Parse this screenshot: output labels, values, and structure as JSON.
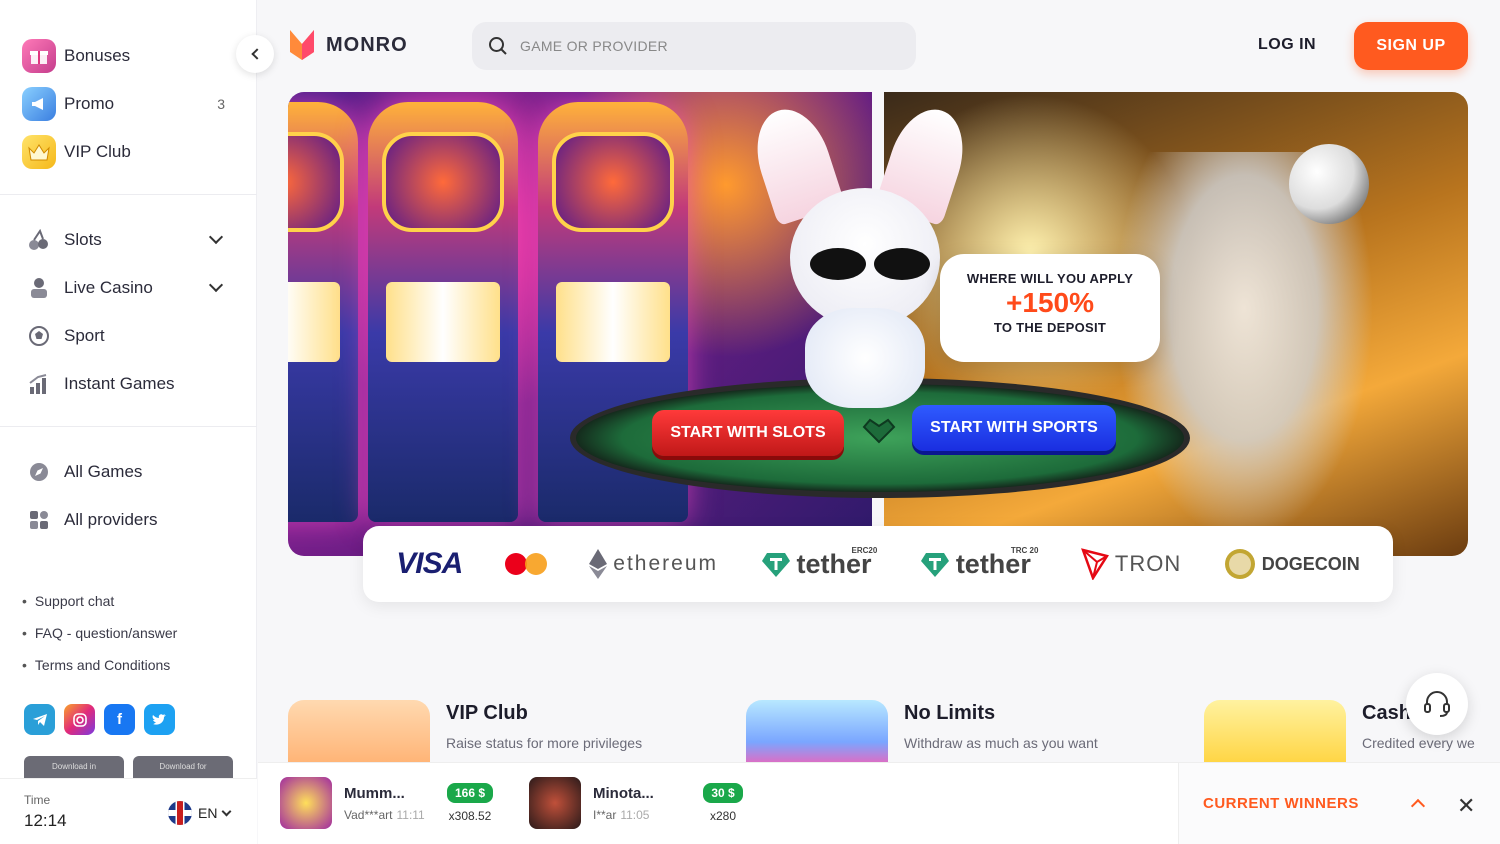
{
  "sidebar": {
    "top_items": [
      {
        "label": "Bonuses",
        "count": ""
      },
      {
        "label": "Promo",
        "count": "3"
      },
      {
        "label": "VIP Club",
        "count": ""
      }
    ],
    "games_items": [
      {
        "label": "Slots"
      },
      {
        "label": "Live Casino"
      },
      {
        "label": "Sport"
      },
      {
        "label": "Instant Games"
      }
    ],
    "catalog_items": [
      {
        "label": "All Games"
      },
      {
        "label": "All providers"
      }
    ],
    "links": [
      "Support chat",
      "FAQ - question/answer",
      "Terms and Conditions"
    ],
    "download": [
      "Download in",
      "Download for"
    ],
    "time_label": "Time",
    "time_value": "12:14",
    "language": "EN"
  },
  "header": {
    "logo_text": "MONRO",
    "search_placeholder": "GAME OR PROVIDER",
    "login_label": "LOG IN",
    "signup_label": "SIGN UP"
  },
  "banner": {
    "promo_line1": "WHERE WILL YOU APPLY",
    "promo_percent": "+150%",
    "promo_line2": "TO THE DEPOSIT",
    "slots_button": "START WITH SLOTS",
    "sports_button": "START WITH SPORTS"
  },
  "payments": {
    "visa": "VISA",
    "ethereum": "ethereum",
    "tether": "tether",
    "erc20": "ERC20",
    "trc20": "TRC 20",
    "tron": "TRON",
    "dogecoin": "DOGECOIN"
  },
  "features": [
    {
      "title": "VIP Club",
      "subtitle": "Raise status for more privileges"
    },
    {
      "title": "No Limits",
      "subtitle": "Withdraw as much as you want"
    },
    {
      "title": "Cash",
      "subtitle": "Credited every we"
    }
  ],
  "winners": {
    "items": [
      {
        "game": "Mumm...",
        "user": "Vad***art",
        "time": "11:11",
        "amount": "166 $",
        "multiplier": "x308.52"
      },
      {
        "game": "Minota...",
        "user": "I**ar",
        "time": "11:05",
        "amount": "30 $",
        "multiplier": "x280"
      }
    ],
    "current_label": "CURRENT WINNERS"
  },
  "colors": {
    "accent": "#ff5a1f",
    "green": "#1aa84a",
    "blue": "#1a2ee0",
    "red": "#c01818"
  }
}
